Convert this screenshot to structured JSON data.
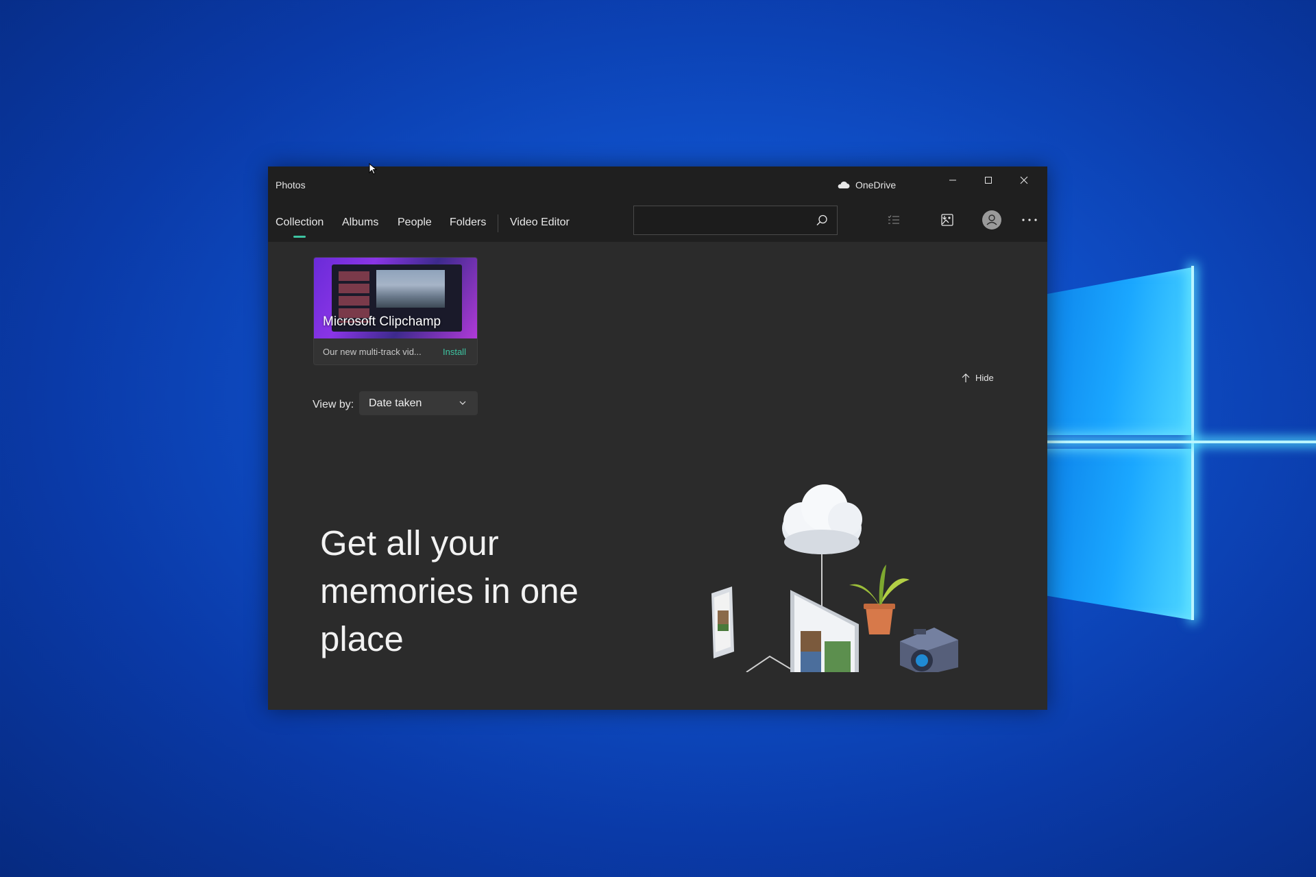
{
  "window": {
    "app_title": "Photos",
    "onedrive_label": "OneDrive",
    "controls": [
      "minimize",
      "maximize",
      "close"
    ]
  },
  "nav": {
    "tabs": [
      {
        "label": "Collection",
        "active": true
      },
      {
        "label": "Albums"
      },
      {
        "label": "People"
      },
      {
        "label": "Folders"
      },
      {
        "label": "Video Editor"
      }
    ],
    "search": {
      "value": "",
      "placeholder": ""
    },
    "icons": [
      "search-icon",
      "select-icon",
      "import-icon",
      "account-icon",
      "more-icon"
    ]
  },
  "promo": {
    "title": "Microsoft Clipchamp",
    "description": "Our new multi-track vid...",
    "install_label": "Install"
  },
  "hide_label": "Hide",
  "view_by": {
    "label": "View by:",
    "selected": "Date taken"
  },
  "hero": {
    "line1": "Get all your",
    "line2": "memories in one",
    "line3": "place"
  },
  "colors": {
    "accent": "#3ec5a2",
    "window_bg": "#2b2b2b",
    "titlebar_bg": "#1f1f1f",
    "desktop_blue": "#0f4fc8"
  }
}
